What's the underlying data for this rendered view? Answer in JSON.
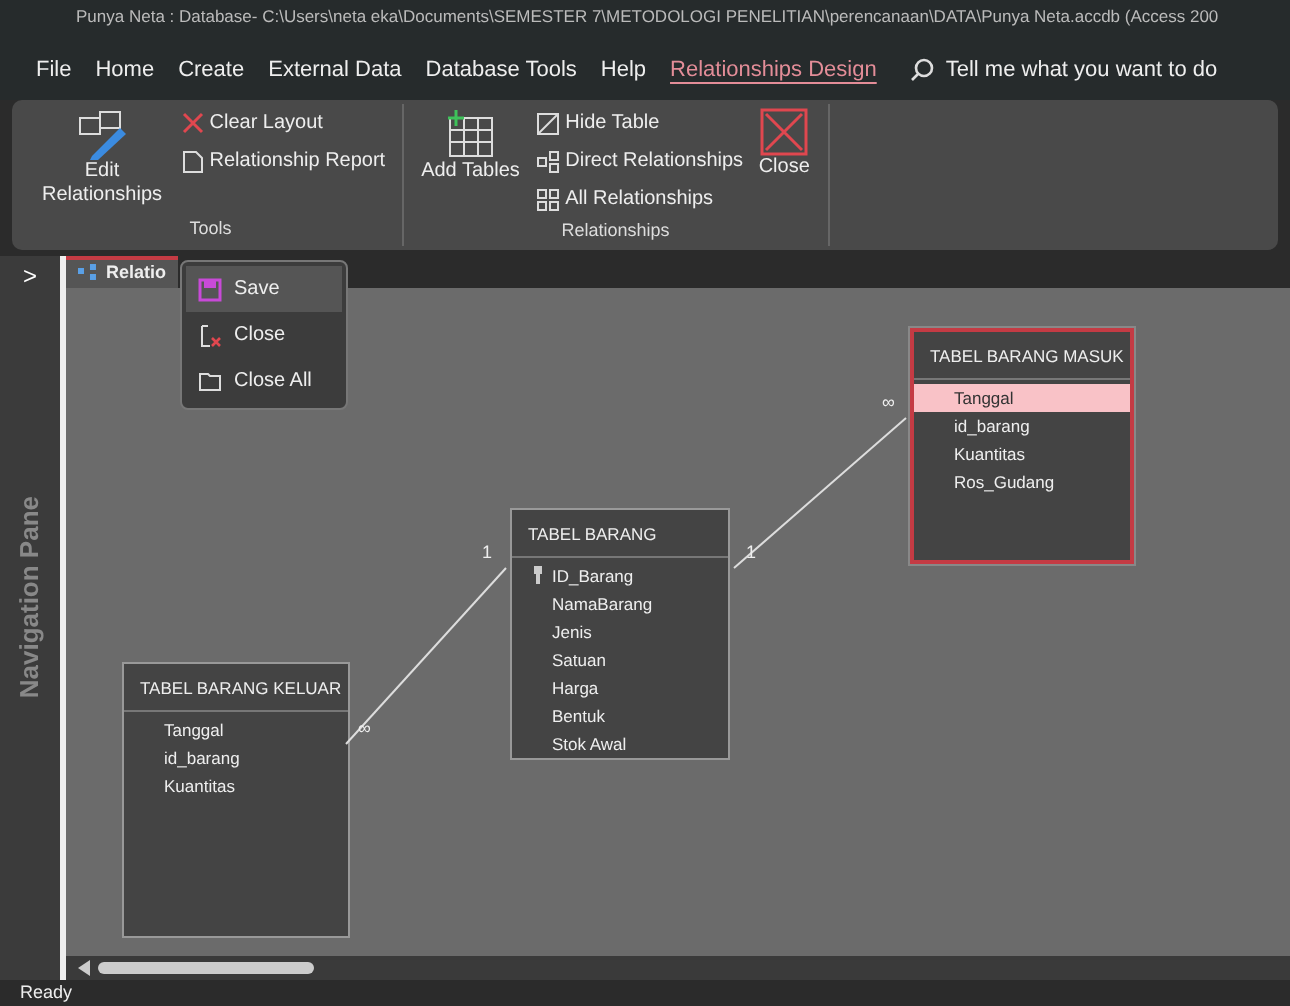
{
  "window": {
    "title": "Punya Neta : Database- C:\\Users\\neta eka\\Documents\\SEMESTER 7\\METODOLOGI PENELITIAN\\perencanaan\\DATA\\Punya Neta.accdb (Access 200"
  },
  "ribbon_tabs": [
    {
      "label": "File",
      "selected": false
    },
    {
      "label": "Home",
      "selected": false
    },
    {
      "label": "Create",
      "selected": false
    },
    {
      "label": "External Data",
      "selected": false
    },
    {
      "label": "Database Tools",
      "selected": false
    },
    {
      "label": "Help",
      "selected": false
    },
    {
      "label": "Relationships Design",
      "selected": true
    }
  ],
  "tell_me": "Tell me what you want to do",
  "ribbon_groups": [
    {
      "label": "Tools",
      "commands": [
        {
          "kind": "large",
          "label": "Edit Relationships"
        },
        {
          "kind": "small",
          "label": "Clear Layout"
        },
        {
          "kind": "small",
          "label": "Relationship Report"
        }
      ]
    },
    {
      "label": "Relationships",
      "commands": [
        {
          "kind": "large",
          "label": "Add Tables"
        },
        {
          "kind": "small",
          "label": "Hide Table"
        },
        {
          "kind": "small",
          "label": "Direct Relationships"
        },
        {
          "kind": "small",
          "label": "All Relationships"
        },
        {
          "kind": "large",
          "label": "Close"
        }
      ]
    }
  ],
  "nav_pane": {
    "toggle": ">",
    "label": "Navigation Pane"
  },
  "document_tab": {
    "label": "Relatio"
  },
  "context_menu": [
    {
      "label": "Save",
      "selected": true
    },
    {
      "label": "Close",
      "selected": false
    },
    {
      "label": "Close All",
      "selected": false
    }
  ],
  "tables": [
    {
      "title": "TABEL BARANG MASUK",
      "selected": true,
      "fields": [
        {
          "name": "Tanggal",
          "key": false,
          "selected": true
        },
        {
          "name": "id_barang",
          "key": false,
          "selected": false
        },
        {
          "name": "Kuantitas",
          "key": false,
          "selected": false
        },
        {
          "name": "Ros_Gudang",
          "key": false,
          "selected": false
        }
      ]
    },
    {
      "title": "TABEL BARANG",
      "selected": false,
      "fields": [
        {
          "name": "ID_Barang",
          "key": true,
          "selected": false
        },
        {
          "name": "NamaBarang",
          "key": false,
          "selected": false
        },
        {
          "name": "Jenis",
          "key": false,
          "selected": false
        },
        {
          "name": "Satuan",
          "key": false,
          "selected": false
        },
        {
          "name": "Harga",
          "key": false,
          "selected": false
        },
        {
          "name": "Bentuk",
          "key": false,
          "selected": false
        },
        {
          "name": "Stok Awal",
          "key": false,
          "selected": false
        }
      ]
    },
    {
      "title": "TABEL BARANG KELUAR",
      "selected": false,
      "fields": [
        {
          "name": "Tanggal",
          "key": false,
          "selected": false
        },
        {
          "name": "id_barang",
          "key": false,
          "selected": false
        },
        {
          "name": "Kuantitas",
          "key": false,
          "selected": false
        }
      ]
    }
  ],
  "relationships": [
    {
      "from_label": "∞",
      "to_label": "1"
    },
    {
      "from_label": "1",
      "to_label": "∞"
    }
  ],
  "status_bar": "Ready"
}
